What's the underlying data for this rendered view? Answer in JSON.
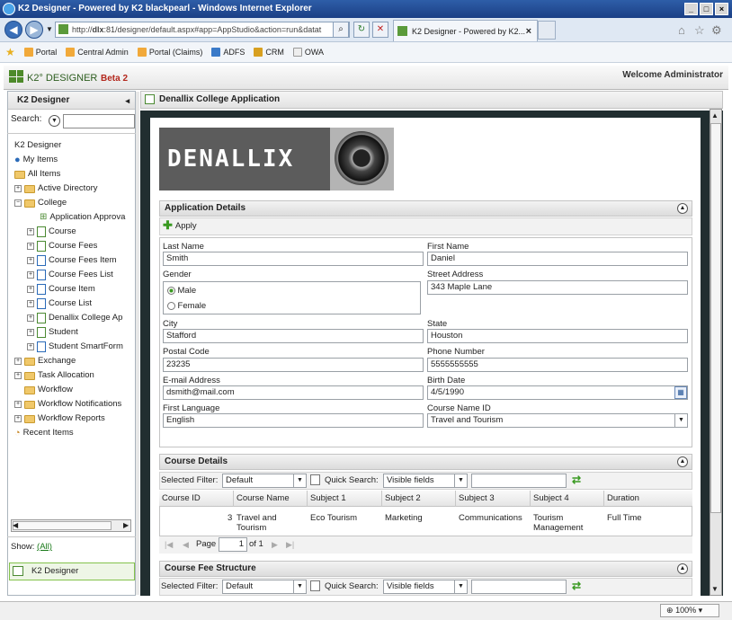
{
  "window": {
    "title": "K2 Designer - Powered by K2 blackpearl - Windows Internet Explorer"
  },
  "browser": {
    "address_prefix": "http://",
    "address_host": "dlx",
    "address_rest": ":81/designer/default.aspx#app=AppStudio&action=run&datat",
    "tab_title": "K2 Designer - Powered by K2...",
    "favorites": [
      "Portal",
      "Central Admin",
      "Portal (Claims)",
      "ADFS",
      "CRM",
      "OWA"
    ],
    "zoom": "100%"
  },
  "app": {
    "logo_text": "K2° DESIGNER",
    "beta": "Beta 2",
    "welcome": "Welcome Administrator"
  },
  "left_panel": {
    "title": "K2 Designer",
    "search_label": "Search:",
    "show_label": "Show:",
    "show_value": "(All)",
    "nav_item": "K2 Designer",
    "tree": [
      {
        "label": "K2 Designer"
      },
      {
        "label": "My Items"
      },
      {
        "label": "All Items"
      },
      {
        "label": "Active Directory"
      },
      {
        "label": "College"
      },
      {
        "label": "Application Approva"
      },
      {
        "label": "Course"
      },
      {
        "label": "Course Fees"
      },
      {
        "label": "Course Fees Item"
      },
      {
        "label": "Course Fees List"
      },
      {
        "label": "Course Item"
      },
      {
        "label": "Course List"
      },
      {
        "label": "Denallix College Ap"
      },
      {
        "label": "Student"
      },
      {
        "label": "Student SmartForm"
      },
      {
        "label": "Exchange"
      },
      {
        "label": "Task Allocation"
      },
      {
        "label": "Workflow"
      },
      {
        "label": "Workflow Notifications"
      },
      {
        "label": "Workflow Reports"
      },
      {
        "label": "Recent Items"
      }
    ]
  },
  "main": {
    "title": "Denallix College Application",
    "banner_text": "DENALLIX",
    "app_details": {
      "title": "Application Details",
      "apply_label": "Apply",
      "fields": {
        "last_name_label": "Last Name",
        "last_name": "Smith",
        "first_name_label": "First Name",
        "first_name": "Daniel",
        "gender_label": "Gender",
        "male": "Male",
        "female": "Female",
        "street_label": "Street Address",
        "street": "343 Maple Lane",
        "city_label": "City",
        "city": "Stafford",
        "state_label": "State",
        "state": "Houston",
        "postal_label": "Postal Code",
        "postal": "23235",
        "phone_label": "Phone Number",
        "phone": "5555555555",
        "email_label": "E-mail Address",
        "email": "dsmith@mail.com",
        "birth_label": "Birth Date",
        "birth": "4/5/1990",
        "language_label": "First Language",
        "language": "English",
        "course_label": "Course Name ID",
        "course": "Travel and Tourism"
      }
    },
    "course_details": {
      "title": "Course Details",
      "filter_label": "Selected Filter:",
      "filter_value": "Default",
      "quick_search_label": "Quick Search:",
      "quick_search_value": "Visible fields",
      "columns": [
        "Course ID",
        "Course Name",
        "Subject 1",
        "Subject 2",
        "Subject 3",
        "Subject 4",
        "Duration"
      ],
      "row": {
        "id": "3",
        "name": "Travel and Tourism",
        "s1": "Eco Tourism",
        "s2": "Marketing",
        "s3": "Communications",
        "s4": "Tourism Management",
        "duration": "Full Time"
      },
      "page_label": "Page",
      "page_value": "1",
      "page_of": "of 1"
    },
    "course_fee": {
      "title": "Course Fee Structure",
      "filter_label": "Selected Filter:",
      "filter_value": "Default",
      "quick_search_label": "Quick Search:",
      "quick_search_value": "Visible fields"
    }
  }
}
